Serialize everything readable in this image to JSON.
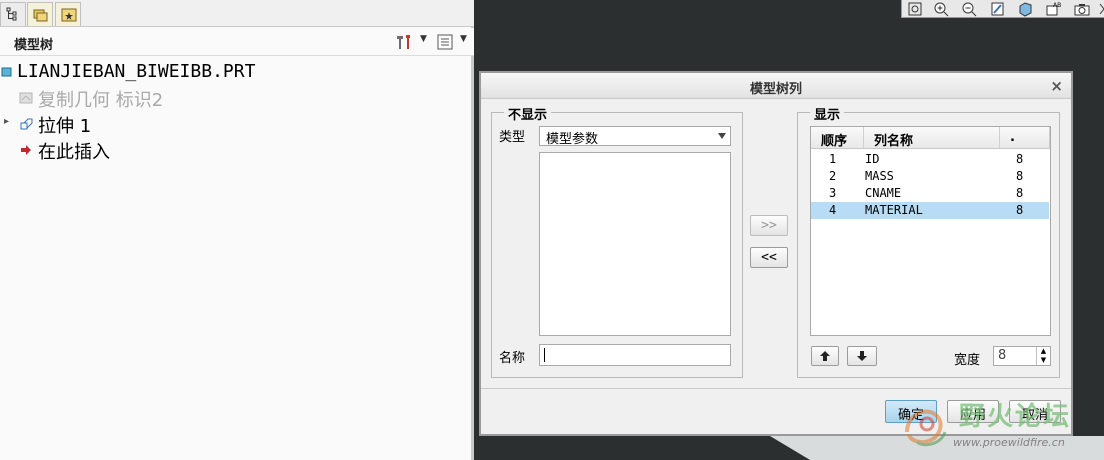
{
  "left_panel": {
    "title": "模型树",
    "tree": [
      {
        "label": "LIANJIEBAN_BIWEIBB.PRT",
        "muted": false
      },
      {
        "label": "复制几何 标识2",
        "muted": true
      },
      {
        "label": "拉伸 1",
        "muted": false
      },
      {
        "label": "在此插入",
        "muted": false
      }
    ]
  },
  "dialog": {
    "title": "模型树列",
    "close": "×",
    "hidden_group": {
      "title": "不显示",
      "type_label": "类型",
      "type_value": "模型参数",
      "name_label": "名称",
      "name_value": ""
    },
    "move_right": ">>",
    "move_left": "<<",
    "shown_group": {
      "title": "显示",
      "columns": [
        "顺序",
        "列名称",
        "."
      ],
      "rows": [
        {
          "order": "1",
          "name": "ID",
          "width": "8"
        },
        {
          "order": "2",
          "name": "MASS",
          "width": "8"
        },
        {
          "order": "3",
          "name": "CNAME",
          "width": "8"
        },
        {
          "order": "4",
          "name": "MATERIAL",
          "width": "8"
        }
      ],
      "width_label": "宽度",
      "width_value": "8"
    },
    "ok": "确定",
    "apply": "应用",
    "cancel": "取消"
  },
  "watermark": {
    "text": "野火论坛",
    "url": "www.proewildfire.cn"
  },
  "colors": {
    "selected_row": "#b7dcf5",
    "ok_button": "#a9d3ee",
    "viewport": "#2b2f30"
  }
}
